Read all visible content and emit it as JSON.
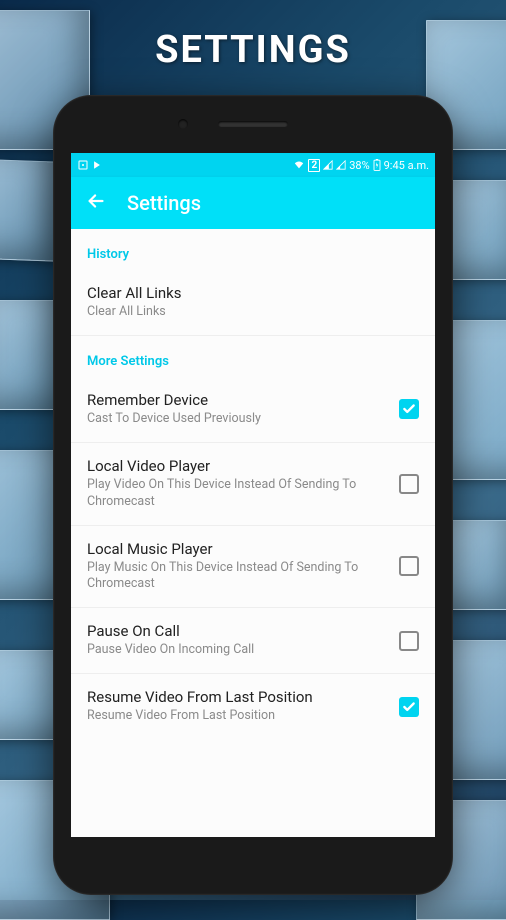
{
  "page_heading": "SETTINGS",
  "status_bar": {
    "battery": "38%",
    "time": "9:45 a.m.",
    "sim_label": "2"
  },
  "app_bar": {
    "title": "Settings"
  },
  "sections": {
    "history": {
      "label": "History",
      "clear_links": {
        "title": "Clear All Links",
        "subtitle": "Clear All Links"
      }
    },
    "more": {
      "label": "More Settings",
      "remember_device": {
        "title": "Remember Device",
        "subtitle": "Cast To Device Used Previously",
        "checked": true
      },
      "local_video": {
        "title": "Local Video Player",
        "subtitle": "Play Video On This Device Instead Of Sending To Chromecast",
        "checked": false
      },
      "local_music": {
        "title": "Local Music Player",
        "subtitle": "Play Music On This Device Instead Of Sending To Chromecast",
        "checked": false
      },
      "pause_call": {
        "title": "Pause On Call",
        "subtitle": "Pause Video On Incoming Call",
        "checked": false
      },
      "resume_video": {
        "title": "Resume Video From Last Position",
        "subtitle": "Resume Video From Last Position",
        "checked": true
      }
    }
  }
}
